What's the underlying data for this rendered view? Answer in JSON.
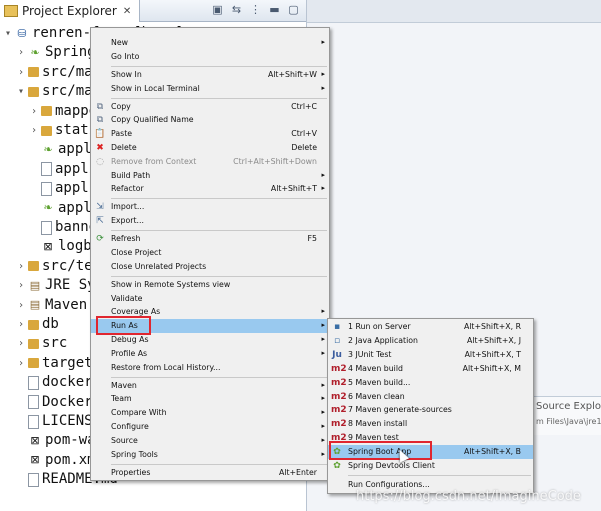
{
  "explorer": {
    "title": "Project Explorer",
    "tree": [
      {
        "twisty": "▾",
        "icon": "project-icon",
        "label": "renren-fast [boot]",
        "indent": 0
      },
      {
        "twisty": "›",
        "icon": "spring-icon",
        "label": "Spring",
        "indent": 1
      },
      {
        "twisty": "›",
        "icon": "source-folder-icon",
        "label": "src/ma",
        "indent": 1
      },
      {
        "twisty": "▾",
        "icon": "source-folder-icon",
        "label": "src/ma",
        "indent": 1
      },
      {
        "twisty": "›",
        "icon": "folder-icon",
        "label": "mappe",
        "indent": 2
      },
      {
        "twisty": "›",
        "icon": "folder-icon",
        "label": "stati",
        "indent": 2
      },
      {
        "twisty": "",
        "icon": "spring-config-icon",
        "label": "appli",
        "indent": 2
      },
      {
        "twisty": "",
        "icon": "file-icon",
        "label": "appli",
        "indent": 2
      },
      {
        "twisty": "",
        "icon": "file-icon",
        "label": "appli",
        "indent": 2
      },
      {
        "twisty": "",
        "icon": "spring-config-icon",
        "label": "appli",
        "indent": 2
      },
      {
        "twisty": "",
        "icon": "file-icon",
        "label": "banne",
        "indent": 2
      },
      {
        "twisty": "",
        "icon": "xml-file-icon",
        "label": "logba",
        "indent": 2
      },
      {
        "twisty": "›",
        "icon": "source-folder-icon",
        "label": "src/te",
        "indent": 1
      },
      {
        "twisty": "›",
        "icon": "library-icon",
        "label": "JRE Sy",
        "indent": 1
      },
      {
        "twisty": "›",
        "icon": "library-icon",
        "label": "Maven",
        "indent": 1
      },
      {
        "twisty": "›",
        "icon": "folder-icon",
        "label": "db",
        "indent": 1
      },
      {
        "twisty": "›",
        "icon": "folder-icon",
        "label": "src",
        "indent": 1
      },
      {
        "twisty": "›",
        "icon": "folder-icon",
        "label": "target",
        "indent": 1
      },
      {
        "twisty": "",
        "icon": "file-icon",
        "label": "docker",
        "indent": 1
      },
      {
        "twisty": "",
        "icon": "file-icon",
        "label": "Docker",
        "indent": 1
      },
      {
        "twisty": "",
        "icon": "file-icon",
        "label": "LICENS",
        "indent": 1
      },
      {
        "twisty": "",
        "icon": "xml-file-icon",
        "label": "pom-wa",
        "indent": 1
      },
      {
        "twisty": "",
        "icon": "xml-file-icon",
        "label": "pom.xm",
        "indent": 1
      },
      {
        "twisty": "",
        "icon": "file-icon",
        "label": "README.md",
        "indent": 1
      }
    ]
  },
  "main_menu": [
    {
      "label": "New",
      "shortcut": "",
      "arrow": true,
      "icon": ""
    },
    {
      "label": "Go Into",
      "shortcut": "",
      "arrow": false,
      "icon": ""
    },
    {
      "sep": true
    },
    {
      "label": "Show In",
      "shortcut": "Alt+Shift+W",
      "arrow": true,
      "icon": ""
    },
    {
      "label": "Show in Local Terminal",
      "shortcut": "",
      "arrow": true,
      "icon": ""
    },
    {
      "sep": true
    },
    {
      "label": "Copy",
      "shortcut": "Ctrl+C",
      "arrow": false,
      "icon": "copy-icon"
    },
    {
      "label": "Copy Qualified Name",
      "shortcut": "",
      "arrow": false,
      "icon": "copy-icon"
    },
    {
      "label": "Paste",
      "shortcut": "Ctrl+V",
      "arrow": false,
      "icon": "paste-icon"
    },
    {
      "label": "Delete",
      "shortcut": "Delete",
      "arrow": false,
      "icon": "delete-icon"
    },
    {
      "label": "Remove from Context",
      "shortcut": "Ctrl+Alt+Shift+Down",
      "arrow": false,
      "icon": "remove-context-icon",
      "disabled": true
    },
    {
      "label": "Build Path",
      "shortcut": "",
      "arrow": true,
      "icon": ""
    },
    {
      "label": "Refactor",
      "shortcut": "Alt+Shift+T",
      "arrow": true,
      "icon": ""
    },
    {
      "sep": true
    },
    {
      "label": "Import...",
      "shortcut": "",
      "arrow": false,
      "icon": "import-icon"
    },
    {
      "label": "Export...",
      "shortcut": "",
      "arrow": false,
      "icon": "export-icon"
    },
    {
      "sep": true
    },
    {
      "label": "Refresh",
      "shortcut": "F5",
      "arrow": false,
      "icon": "refresh-icon"
    },
    {
      "label": "Close Project",
      "shortcut": "",
      "arrow": false,
      "icon": ""
    },
    {
      "label": "Close Unrelated Projects",
      "shortcut": "",
      "arrow": false,
      "icon": ""
    },
    {
      "sep": true
    },
    {
      "label": "Show in Remote Systems view",
      "shortcut": "",
      "arrow": false,
      "icon": ""
    },
    {
      "label": "Validate",
      "shortcut": "",
      "arrow": false,
      "icon": ""
    },
    {
      "label": "Coverage As",
      "shortcut": "",
      "arrow": true,
      "icon": ""
    },
    {
      "label": "Run As",
      "shortcut": "",
      "arrow": true,
      "icon": "",
      "highlight": true
    },
    {
      "label": "Debug As",
      "shortcut": "",
      "arrow": true,
      "icon": ""
    },
    {
      "label": "Profile As",
      "shortcut": "",
      "arrow": true,
      "icon": ""
    },
    {
      "label": "Restore from Local History...",
      "shortcut": "",
      "arrow": false,
      "icon": ""
    },
    {
      "sep": true
    },
    {
      "label": "Maven",
      "shortcut": "",
      "arrow": true,
      "icon": ""
    },
    {
      "label": "Team",
      "shortcut": "",
      "arrow": true,
      "icon": ""
    },
    {
      "label": "Compare With",
      "shortcut": "",
      "arrow": true,
      "icon": ""
    },
    {
      "label": "Configure",
      "shortcut": "",
      "arrow": true,
      "icon": ""
    },
    {
      "label": "Source",
      "shortcut": "",
      "arrow": true,
      "icon": ""
    },
    {
      "label": "Spring Tools",
      "shortcut": "",
      "arrow": true,
      "icon": ""
    },
    {
      "sep": true
    },
    {
      "label": "Properties",
      "shortcut": "Alt+Enter",
      "arrow": false,
      "icon": ""
    }
  ],
  "run_as_menu": [
    {
      "label": "1 Run on Server",
      "shortcut": "Alt+Shift+X, R",
      "icon": "server-icon",
      "glyph": "▪"
    },
    {
      "label": "2 Java Application",
      "shortcut": "Alt+Shift+X, J",
      "icon": "java-app-icon",
      "glyph": "▫"
    },
    {
      "label": "3 JUnit Test",
      "shortcut": "Alt+Shift+X, T",
      "icon": "junit-icon",
      "glyph": "Ju"
    },
    {
      "label": "4 Maven build",
      "shortcut": "Alt+Shift+X, M",
      "icon": "maven-icon",
      "glyph": "m2"
    },
    {
      "label": "5 Maven build...",
      "shortcut": "",
      "icon": "maven-icon",
      "glyph": "m2"
    },
    {
      "label": "6 Maven clean",
      "shortcut": "",
      "icon": "maven-icon",
      "glyph": "m2"
    },
    {
      "label": "7 Maven generate-sources",
      "shortcut": "",
      "icon": "maven-icon",
      "glyph": "m2"
    },
    {
      "label": "8 Maven install",
      "shortcut": "",
      "icon": "maven-icon",
      "glyph": "m2"
    },
    {
      "label": "9 Maven test",
      "shortcut": "",
      "icon": "maven-icon",
      "glyph": "m2"
    },
    {
      "label": "Spring Boot App",
      "shortcut": "Alt+Shift+X, B",
      "icon": "spring-boot-icon",
      "glyph": "✿",
      "highlight": true
    },
    {
      "label": "Spring Devtools Client",
      "shortcut": "",
      "icon": "spring-devtools-icon",
      "glyph": "✿"
    },
    {
      "sep": true
    },
    {
      "label": "Run Configurations...",
      "shortcut": "",
      "icon": "",
      "glyph": ""
    }
  ],
  "background": {
    "source_explorer_title": "Source Explore",
    "source_explorer_path": "m Files\\Java\\jre1."
  },
  "watermark": "https://blog.csdn.net/ImagineCode",
  "colors": {
    "highlight": "#99c9ef",
    "callout": "#e0262f",
    "menu_bg": "#f0f0f0"
  }
}
